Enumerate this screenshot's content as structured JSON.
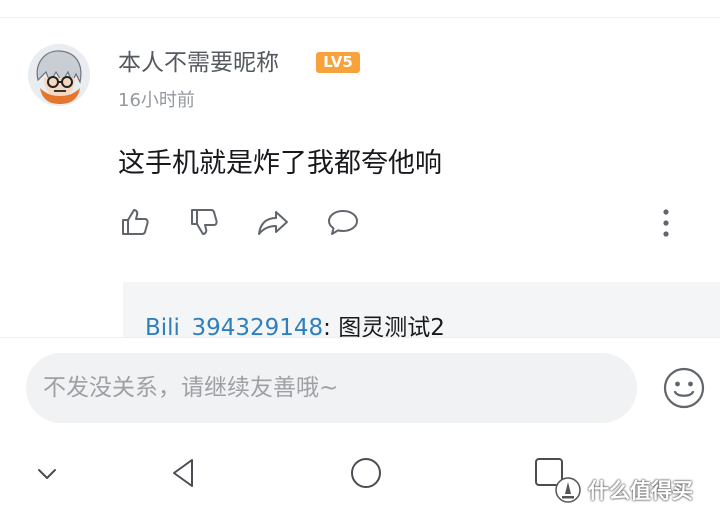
{
  "comment": {
    "username": "本人不需要昵称",
    "level": "LV5",
    "timestamp": "16小时前",
    "text": "这手机就是炸了我都夸他响",
    "icons": {
      "like": "thumbs-up-icon",
      "dislike": "thumbs-down-icon",
      "share": "share-icon",
      "reply": "comment-icon",
      "more": "more-vertical-icon"
    },
    "level_color": "#f7a23a"
  },
  "reply_preview": {
    "user": "Bili_394329148",
    "separator": ": ",
    "text": "图灵测试2",
    "user_color": "#2f7fbf"
  },
  "input": {
    "placeholder": "不发没关系，请继续友善哦~"
  },
  "nav": {
    "icons": [
      "chevron-down-icon",
      "back-triangle-icon",
      "home-circle-icon",
      "recents-square-icon"
    ]
  },
  "watermark": {
    "text": "什么值得买"
  }
}
